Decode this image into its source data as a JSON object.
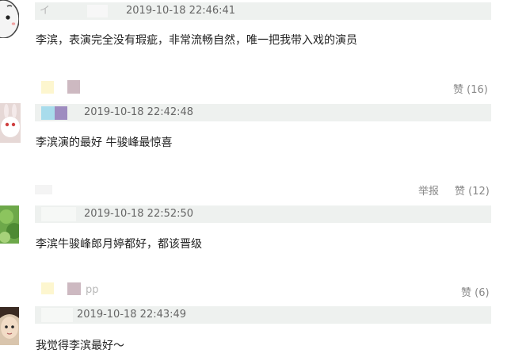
{
  "comments": [
    {
      "timestamp": "2019-10-18 22:46:41",
      "text": "李滨，表演完全没有瑕疵，非常流畅自然，唯一把我带入戏的演员",
      "like_label": "赞 (16)"
    },
    {
      "timestamp": "2019-10-18 22:42:48",
      "text": "李滨演的最好 牛骏峰最惊喜",
      "report_label": "举报",
      "like_label": "赞 (12)"
    },
    {
      "timestamp": "2019-10-18 22:52:50",
      "text": "李滨牛骏峰郎月婷都好，都该晋级",
      "like_label": "赞 (6)"
    },
    {
      "timestamp": "2019-10-18 22:43:49",
      "text": "我觉得李滨最好～"
    }
  ],
  "partial_names": {
    "first": "イ",
    "fourth": "pp"
  },
  "colors": {
    "header_bar": "#eef1ef",
    "yellow_block": "#fdf6cf",
    "mauve_block": "#cdb9c1",
    "cyan_block": "#a8dcec",
    "purple_block": "#9e8cc0"
  }
}
